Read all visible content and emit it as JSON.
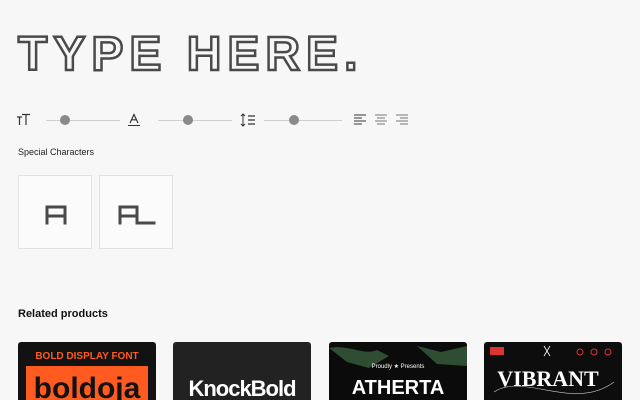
{
  "preview": {
    "text": "TYPE HERE."
  },
  "controls": {
    "size": {
      "icon": "text-size-icon",
      "value": 0.5
    },
    "tracking": {
      "icon": "letter-spacing-icon",
      "value": 0.5
    },
    "line_height": {
      "icon": "line-height-icon",
      "value": 0.5
    },
    "align": [
      "align-left-icon",
      "align-center-icon",
      "align-right-icon"
    ]
  },
  "special": {
    "label": "Special Characters",
    "glyphs": [
      "alternate-a-glyph",
      "alternate-al-ligature-glyph"
    ]
  },
  "related": {
    "title": "Related products",
    "products": [
      {
        "tag": "BOLD DISPLAY FONT",
        "name": "boldoja",
        "bg": "#121212",
        "accent": "#ff5a1f"
      },
      {
        "name": "KnockBold",
        "bg": "#222222",
        "accent": "#ffffff"
      },
      {
        "tag": "Proudly ★ Presents",
        "name": "ATHERTA",
        "bg": "#0b0b0b",
        "accent": "#ffffff"
      },
      {
        "name": "VIBRANT",
        "bg": "#0d0d0d",
        "accent": "#ffffff"
      }
    ]
  },
  "colors": {
    "background": "#f7f7f7",
    "glyph": "#4a4a4a",
    "slider_thumb": "#8a8a8a"
  }
}
